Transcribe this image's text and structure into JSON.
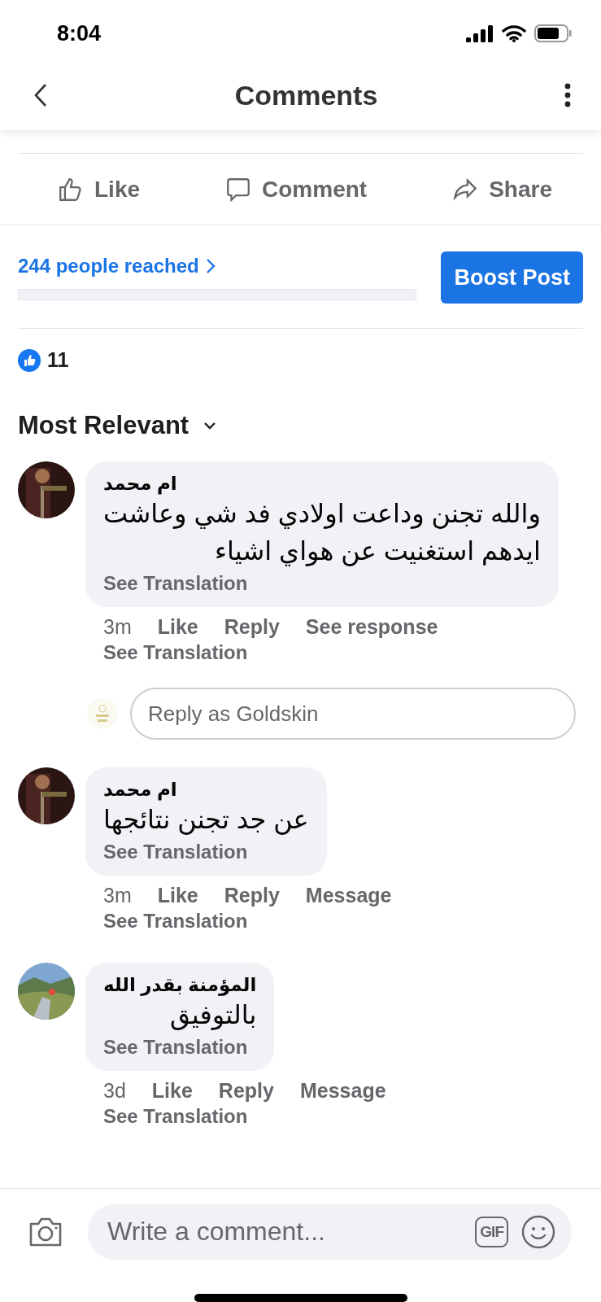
{
  "status_bar": {
    "time": "8:04"
  },
  "header": {
    "title": "Comments"
  },
  "post_actions": [
    {
      "kind": "like",
      "label": "Like"
    },
    {
      "kind": "comment",
      "label": "Comment"
    },
    {
      "kind": "share",
      "label": "Share"
    }
  ],
  "reach": {
    "link": "244 people reached",
    "button": "Boost Post"
  },
  "reactions": {
    "count": "11"
  },
  "sort": {
    "label": "Most Relevant"
  },
  "comments": [
    {
      "author": "ام محمد",
      "text_lines": [
        "والله تجنن وداعت اولادي فد شي وعاشت",
        "ايدهم استغنيت عن هواي اشياء"
      ],
      "bubble_link": "See Translation",
      "time": "3m",
      "actions": [
        "Like",
        "Reply",
        "See response"
      ],
      "footer_link": "See Translation",
      "reply_field": {
        "placeholder": "Reply as Goldskin"
      }
    },
    {
      "author": "ام محمد",
      "text_lines": [
        "عن جد تجنن نتائجها"
      ],
      "bubble_link": "See Translation",
      "time": "3m",
      "actions": [
        "Like",
        "Reply",
        "Message"
      ],
      "footer_link": "See Translation"
    },
    {
      "author": "المؤمنة بقدر الله",
      "text_lines": [
        "بالتوفيق"
      ],
      "bubble_link": "See Translation",
      "time": "3d",
      "actions": [
        "Like",
        "Reply",
        "Message"
      ],
      "footer_link": "See Translation"
    }
  ],
  "composer": {
    "placeholder": "Write a comment...",
    "gif_label": "GIF"
  }
}
